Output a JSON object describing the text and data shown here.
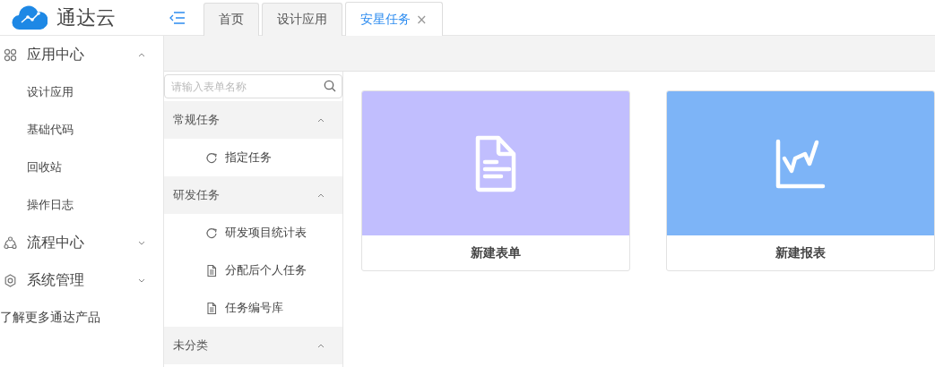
{
  "logo": {
    "text": "通达云"
  },
  "tabs": [
    {
      "label": "首页",
      "selected": false
    },
    {
      "label": "设计应用",
      "selected": false
    },
    {
      "label": "安星任务",
      "selected": true,
      "close": "×"
    }
  ],
  "sidebar": {
    "items": [
      {
        "label": "应用中心",
        "kind": "apps",
        "expanded": true,
        "children": [
          {
            "label": "设计应用"
          },
          {
            "label": "基础代码"
          },
          {
            "label": "回收站"
          },
          {
            "label": "操作日志"
          }
        ]
      },
      {
        "label": "流程中心",
        "kind": "flow",
        "expanded": false
      },
      {
        "label": "系统管理",
        "kind": "gear",
        "expanded": false
      }
    ],
    "more_link": "了解更多通达产品"
  },
  "form_list": {
    "search": {
      "placeholder": "请输入表单名称"
    },
    "groups": [
      {
        "label": "常规任务",
        "expanded": true,
        "items": [
          {
            "label": "指定任务",
            "kind": "flow"
          }
        ]
      },
      {
        "label": "研发任务",
        "expanded": true,
        "items": [
          {
            "label": "研发项目统计表",
            "kind": "flow"
          },
          {
            "label": "分配后个人任务",
            "kind": "doc"
          },
          {
            "label": "任务编号库",
            "kind": "doc"
          }
        ]
      },
      {
        "label": "未分类",
        "expanded": true
      }
    ]
  },
  "cards": [
    {
      "label": "新建表单",
      "kind": "form",
      "color": "#c1befe"
    },
    {
      "label": "新建报表",
      "kind": "report",
      "color": "#7db4f7"
    }
  ]
}
